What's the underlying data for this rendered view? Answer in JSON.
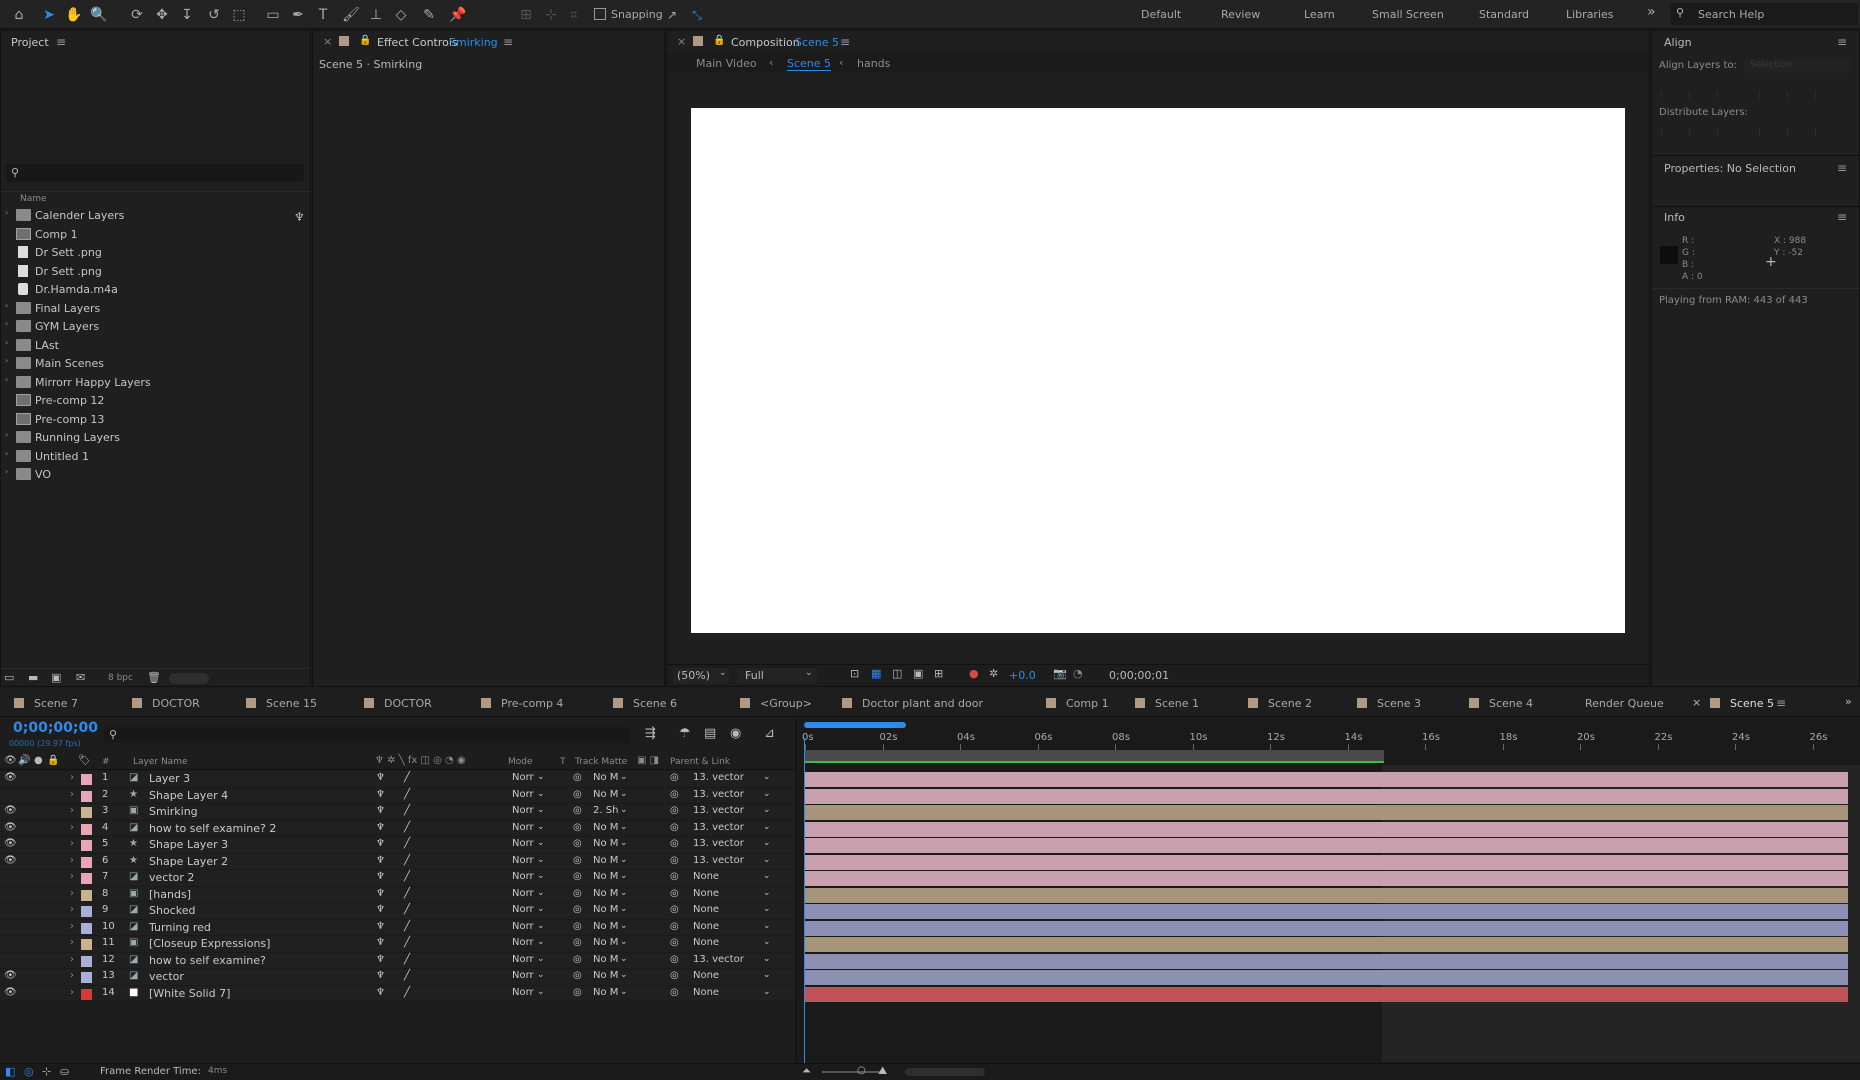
{
  "toolbar": {
    "snapping": "Snapping",
    "workspaces": [
      "Default",
      "Review",
      "Learn",
      "Small Screen",
      "Standard",
      "Libraries"
    ],
    "overflow": "»",
    "search_placeholder": "Search Help"
  },
  "project": {
    "title": "Project",
    "col_name": "Name",
    "items": [
      {
        "name": "Calender Layers",
        "type": "folder",
        "arrow": true
      },
      {
        "name": "Comp 1",
        "type": "comp",
        "arrow": false
      },
      {
        "name": "Dr Sett .png",
        "type": "png",
        "arrow": false
      },
      {
        "name": "Dr Sett .png",
        "type": "png",
        "arrow": false
      },
      {
        "name": "Dr.Hamda.m4a",
        "type": "aud",
        "arrow": false
      },
      {
        "name": "Final Layers",
        "type": "folder",
        "arrow": true
      },
      {
        "name": "GYM Layers",
        "type": "folder",
        "arrow": true
      },
      {
        "name": "LAst",
        "type": "folder",
        "arrow": true
      },
      {
        "name": "Main Scenes",
        "type": "folder",
        "arrow": true
      },
      {
        "name": "Mirrorr Happy Layers",
        "type": "folder",
        "arrow": true
      },
      {
        "name": "Pre-comp 12",
        "type": "comp",
        "arrow": false
      },
      {
        "name": "Pre-comp 13",
        "type": "comp",
        "arrow": false
      },
      {
        "name": "Running Layers",
        "type": "folder",
        "arrow": true
      },
      {
        "name": "Untitled 1",
        "type": "folder",
        "arrow": true
      },
      {
        "name": "VO",
        "type": "folder",
        "arrow": true
      }
    ],
    "bpc": "8 bpc"
  },
  "effect_controls": {
    "title": "Effect Controls",
    "layer": "Smirking",
    "subtitle": "Scene 5 · Smirking"
  },
  "composition": {
    "title": "Composition",
    "name": "Scene 5",
    "breadcrumbs": [
      "Main Video",
      "Scene 5",
      "hands"
    ],
    "zoom": "(50%)",
    "resolution": "Full",
    "exposure": "+0.0",
    "timecode": "0;00;00;01"
  },
  "align": {
    "title": "Align",
    "align_to": "Align Layers to:",
    "align_to_value": "Selection",
    "distribute": "Distribute Layers:"
  },
  "properties": {
    "title": "Properties: No Selection"
  },
  "info": {
    "title": "Info",
    "r": "R :",
    "g": "G :",
    "b": "B :",
    "a": "A : 0",
    "x": "X : 988",
    "y": "Y : -52",
    "status": "Playing from RAM: 443 of 443"
  },
  "timeline_tabs": [
    {
      "label": "Scene 7",
      "color": "#b19a83"
    },
    {
      "label": "DOCTOR",
      "color": "#b19a83"
    },
    {
      "label": "Scene 15",
      "color": "#b19a83"
    },
    {
      "label": "DOCTOR",
      "color": "#b19a83"
    },
    {
      "label": "Pre-comp 4",
      "color": "#b19a83"
    },
    {
      "label": "Scene 6",
      "color": "#b19a83"
    },
    {
      "label": "<Group>",
      "color": "#b19a83"
    },
    {
      "label": "Doctor plant and door",
      "color": "#b19a83"
    },
    {
      "label": "Comp 1",
      "color": "#b19a83"
    },
    {
      "label": "Scene 1",
      "color": "#b19a83"
    },
    {
      "label": "Scene 2",
      "color": "#b19a83"
    },
    {
      "label": "Scene 3",
      "color": "#b19a83"
    },
    {
      "label": "Scene 4",
      "color": "#b19a83"
    },
    {
      "label": "Render Queue",
      "color": ""
    },
    {
      "label": "Scene 5",
      "color": "#b19a83"
    }
  ],
  "timeline": {
    "timecode": "0;00;00;00",
    "fps": "00000 (29.97 fps)",
    "headers": {
      "num": "#",
      "name": "Layer Name",
      "mode": "Mode",
      "t": "T",
      "track": "Track Matte",
      "parent": "Parent & Link"
    },
    "ruler": [
      "0s",
      "02s",
      "04s",
      "06s",
      "08s",
      "10s",
      "12s",
      "14s",
      "16s",
      "18s",
      "20s",
      "22s",
      "24s",
      "26s"
    ],
    "footer": "Frame Render Time:",
    "render_time": "4ms",
    "layers": [
      {
        "n": "1",
        "name": "Layer 3",
        "label": "#e7a6b8",
        "icon": "vec",
        "eye": true,
        "mode": "Norr",
        "tm": "No M",
        "parent": "13. vector",
        "bar": "#c9a0ad"
      },
      {
        "n": "2",
        "name": "Shape Layer 4",
        "label": "#e7a6b8",
        "icon": "star",
        "eye": false,
        "mode": "Norr",
        "tm": "No M",
        "parent": "13. vector",
        "bar": "#c9a0ad"
      },
      {
        "n": "3",
        "name": "Smirking",
        "label": "#c9b28f",
        "icon": "comp",
        "eye": true,
        "mode": "Norr",
        "tm": "2. Sh",
        "parent": "13. vector",
        "bar": "#a6957a"
      },
      {
        "n": "4",
        "name": "how to  self examine? 2",
        "label": "#e7a6b8",
        "icon": "vec",
        "eye": true,
        "mode": "Norr",
        "tm": "No M",
        "parent": "13. vector",
        "bar": "#c9a0ad"
      },
      {
        "n": "5",
        "name": "Shape Layer 3",
        "label": "#e7a6b8",
        "icon": "star",
        "eye": true,
        "mode": "Norr",
        "tm": "No M",
        "parent": "13. vector",
        "bar": "#c9a0ad"
      },
      {
        "n": "6",
        "name": "Shape Layer 2",
        "label": "#e7a6b8",
        "icon": "star",
        "eye": true,
        "mode": "Norr",
        "tm": "No M",
        "parent": "13. vector",
        "bar": "#c9a0ad"
      },
      {
        "n": "7",
        "name": "vector 2",
        "label": "#e7a6b8",
        "icon": "vec",
        "eye": false,
        "mode": "Norr",
        "tm": "No M",
        "parent": "None",
        "bar": "#c9a0ad"
      },
      {
        "n": "8",
        "name": "[hands]",
        "label": "#c9b28f",
        "icon": "comp",
        "eye": false,
        "mode": "Norr",
        "tm": "No M",
        "parent": "None",
        "bar": "#a6957a"
      },
      {
        "n": "9",
        "name": "Shocked",
        "label": "#a9afd6",
        "icon": "vec",
        "eye": false,
        "mode": "Norr",
        "tm": "No M",
        "parent": "None",
        "bar": "#8c91b3"
      },
      {
        "n": "10",
        "name": "Turning red",
        "label": "#a9afd6",
        "icon": "vec",
        "eye": false,
        "mode": "Norr",
        "tm": "No M",
        "parent": "None",
        "bar": "#8c91b3"
      },
      {
        "n": "11",
        "name": "[Closeup Expressions]",
        "label": "#c9b28f",
        "icon": "comp",
        "eye": false,
        "mode": "Norr",
        "tm": "No M",
        "parent": "None",
        "bar": "#a6957a"
      },
      {
        "n": "12",
        "name": "how to  self examine?",
        "label": "#a9afd6",
        "icon": "vec",
        "eye": false,
        "mode": "Norr",
        "tm": "No M",
        "parent": "13. vector",
        "bar": "#8c91b3"
      },
      {
        "n": "13",
        "name": "vector",
        "label": "#a9afd6",
        "icon": "vec",
        "eye": true,
        "mode": "Norr",
        "tm": "No M",
        "parent": "None",
        "bar": "#8c91b3"
      },
      {
        "n": "14",
        "name": "[White Solid 7]",
        "label": "#d23b3b",
        "icon": "solid",
        "eye": true,
        "mode": "Norr",
        "tm": "No M",
        "parent": "None",
        "bar": "#c05259"
      }
    ]
  }
}
